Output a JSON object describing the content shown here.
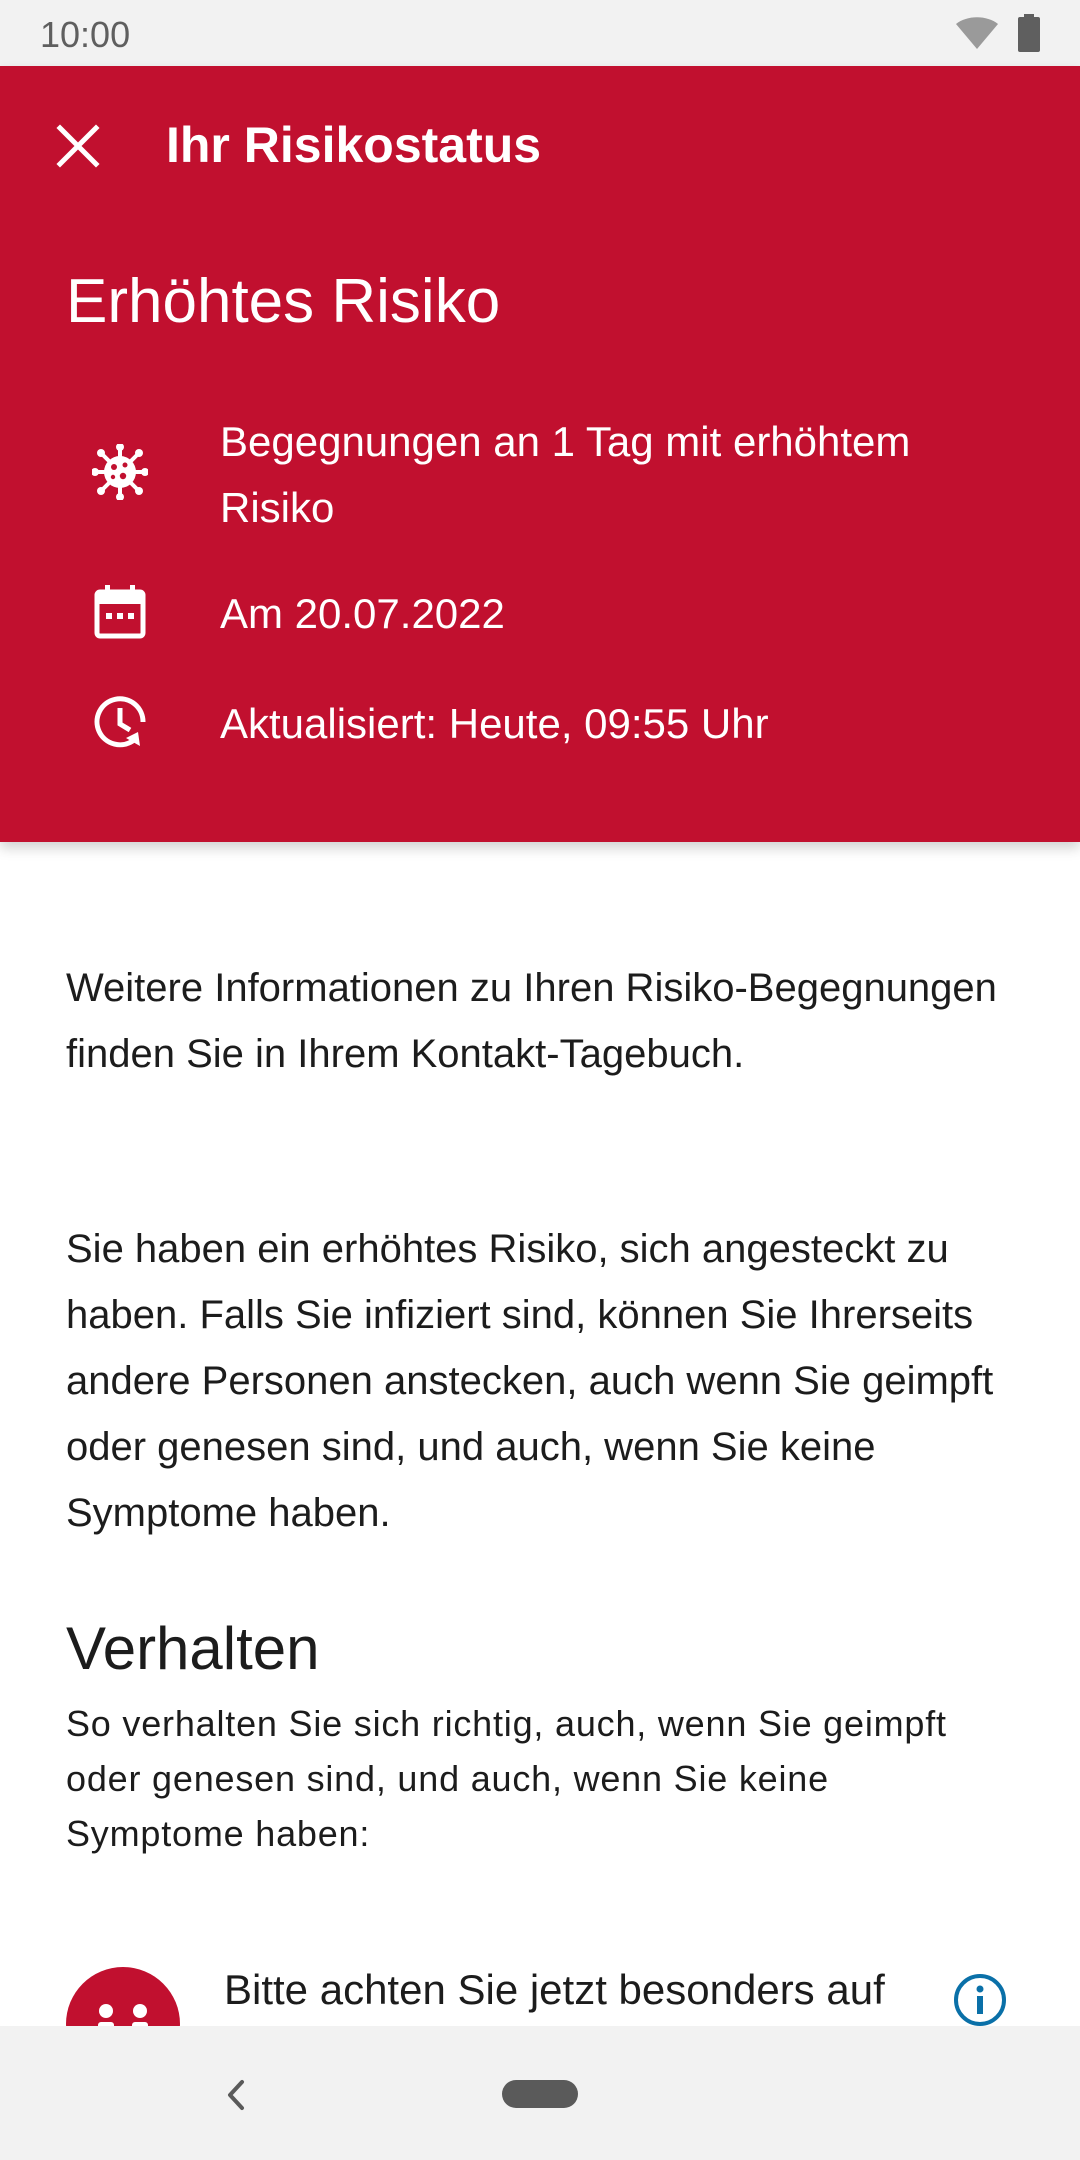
{
  "status_bar": {
    "time": "10:00"
  },
  "header": {
    "title": "Ihr Risikostatus",
    "risk_level": "Erhöhtes Risiko",
    "rows": [
      {
        "icon": "virus-icon",
        "text": "Begegnungen an 1 Tag mit erhöhtem Risiko"
      },
      {
        "icon": "calendar-icon",
        "text": "Am 20.07.2022"
      },
      {
        "icon": "history-clock-icon",
        "text": "Aktualisiert: Heute, 09:55 Uhr"
      }
    ]
  },
  "content": {
    "paragraph1": "Weitere Informationen zu Ihren Risiko-Begegnungen finden Sie in Ihrem Kontakt-Tagebuch.",
    "paragraph2": "Sie haben ein erhöhtes Risiko, sich angesteckt zu haben. Falls Sie infiziert sind, können Sie Ihrerseits andere Personen anstecken, auch wenn Sie geimpft oder genesen sind, und auch, wenn Sie keine Symptome haben.",
    "section_title": "Verhalten",
    "section_subtitle": "So verhalten Sie sich richtig, auch, wenn Sie geimpft oder genesen sind, und auch, wenn Sie keine Symptome haben:",
    "bullet1": "Bitte achten Sie jetzt besonders auf"
  },
  "colors": {
    "accent_red": "#c1102f",
    "info_blue": "#0a70a8"
  }
}
